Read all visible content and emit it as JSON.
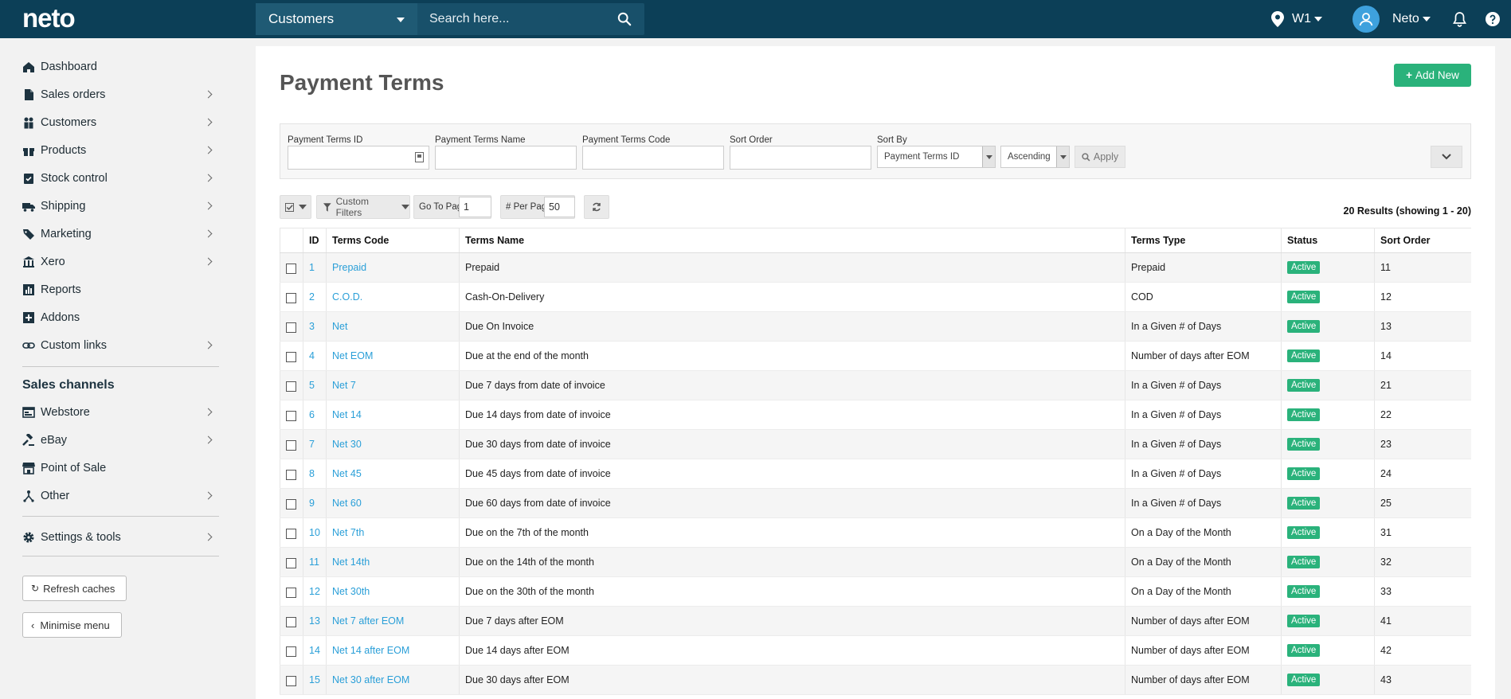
{
  "header": {
    "logo": "neto",
    "search_scope": "Customers",
    "search_placeholder": "Search here...",
    "location": "W1",
    "user": "Neto"
  },
  "sidebar": {
    "items": [
      {
        "label": "Dashboard",
        "icon": "home-icon",
        "chevron": false
      },
      {
        "label": "Sales orders",
        "icon": "document-icon",
        "chevron": true
      },
      {
        "label": "Customers",
        "icon": "users-icon",
        "chevron": true
      },
      {
        "label": "Products",
        "icon": "gift-icon",
        "chevron": true
      },
      {
        "label": "Stock control",
        "icon": "clipboard-check-icon",
        "chevron": true
      },
      {
        "label": "Shipping",
        "icon": "truck-icon",
        "chevron": true
      },
      {
        "label": "Marketing",
        "icon": "tags-icon",
        "chevron": true
      },
      {
        "label": "Xero",
        "icon": "bank-icon",
        "chevron": true
      },
      {
        "label": "Reports",
        "icon": "bar-chart-icon",
        "chevron": false
      },
      {
        "label": "Addons",
        "icon": "plus-square-icon",
        "chevron": false
      },
      {
        "label": "Custom links",
        "icon": "link-icon",
        "chevron": true
      }
    ],
    "channels_title": "Sales channels",
    "channels": [
      {
        "label": "Webstore",
        "icon": "webstore-icon",
        "chevron": true
      },
      {
        "label": "eBay",
        "icon": "gavel-icon",
        "chevron": true
      },
      {
        "label": "Point of Sale",
        "icon": "store-icon",
        "chevron": false
      },
      {
        "label": "Other",
        "icon": "sitemap-icon",
        "chevron": true
      }
    ],
    "settings": {
      "label": "Settings & tools",
      "icon": "gear-icon",
      "chevron": true
    },
    "refresh_label": "Refresh caches",
    "minimise_label": "Minimise menu"
  },
  "page": {
    "title": "Payment Terms",
    "add_new": "Add New"
  },
  "filters": {
    "id_label": "Payment Terms ID",
    "name_label": "Payment Terms Name",
    "code_label": "Payment Terms Code",
    "sort_order_label": "Sort Order",
    "sort_by_label": "Sort By",
    "sort_by_value": "Payment Terms ID",
    "direction_value": "Ascending",
    "apply": "Apply"
  },
  "toolbar": {
    "custom_filters": "Custom Filters",
    "go_to_page_label": "Go To Page",
    "go_to_page_value": "1",
    "per_page_label": "# Per Page",
    "per_page_value": "50",
    "results": "20 Results (showing 1 - 20)"
  },
  "table": {
    "columns": [
      "ID",
      "Terms Code",
      "Terms Name",
      "Terms Type",
      "Status",
      "Sort Order"
    ],
    "rows": [
      {
        "id": "1",
        "code": "Prepaid",
        "name": "Prepaid",
        "type": "Prepaid",
        "status": "Active",
        "sort": "11"
      },
      {
        "id": "2",
        "code": "C.O.D.",
        "name": "Cash-On-Delivery",
        "type": "COD",
        "status": "Active",
        "sort": "12"
      },
      {
        "id": "3",
        "code": "Net",
        "name": "Due On Invoice",
        "type": "In a Given # of Days",
        "status": "Active",
        "sort": "13"
      },
      {
        "id": "4",
        "code": "Net EOM",
        "name": "Due at the end of the month",
        "type": "Number of days after EOM",
        "status": "Active",
        "sort": "14"
      },
      {
        "id": "5",
        "code": "Net 7",
        "name": "Due 7 days from date of invoice",
        "type": "In a Given # of Days",
        "status": "Active",
        "sort": "21"
      },
      {
        "id": "6",
        "code": "Net 14",
        "name": "Due 14 days from date of invoice",
        "type": "In a Given # of Days",
        "status": "Active",
        "sort": "22"
      },
      {
        "id": "7",
        "code": "Net 30",
        "name": "Due 30 days from date of invoice",
        "type": "In a Given # of Days",
        "status": "Active",
        "sort": "23"
      },
      {
        "id": "8",
        "code": "Net 45",
        "name": "Due 45 days from date of invoice",
        "type": "In a Given # of Days",
        "status": "Active",
        "sort": "24"
      },
      {
        "id": "9",
        "code": "Net 60",
        "name": "Due 60 days from date of invoice",
        "type": "In a Given # of Days",
        "status": "Active",
        "sort": "25"
      },
      {
        "id": "10",
        "code": "Net 7th",
        "name": "Due on the 7th of the month",
        "type": "On a Day of the Month",
        "status": "Active",
        "sort": "31"
      },
      {
        "id": "11",
        "code": "Net 14th",
        "name": "Due on the 14th of the month",
        "type": "On a Day of the Month",
        "status": "Active",
        "sort": "32"
      },
      {
        "id": "12",
        "code": "Net 30th",
        "name": "Due on the 30th of the month",
        "type": "On a Day of the Month",
        "status": "Active",
        "sort": "33"
      },
      {
        "id": "13",
        "code": "Net 7 after EOM",
        "name": "Due 7 days after EOM",
        "type": "Number of days after EOM",
        "status": "Active",
        "sort": "41"
      },
      {
        "id": "14",
        "code": "Net 14 after EOM",
        "name": "Due 14 days after EOM",
        "type": "Number of days after EOM",
        "status": "Active",
        "sort": "42"
      },
      {
        "id": "15",
        "code": "Net 30 after EOM",
        "name": "Due 30 days after EOM",
        "type": "Number of days after EOM",
        "status": "Active",
        "sort": "43"
      }
    ]
  },
  "colors": {
    "topbar": "#0c3f57",
    "accent_green": "#2ab27b",
    "link_blue": "#2a9fd8"
  }
}
